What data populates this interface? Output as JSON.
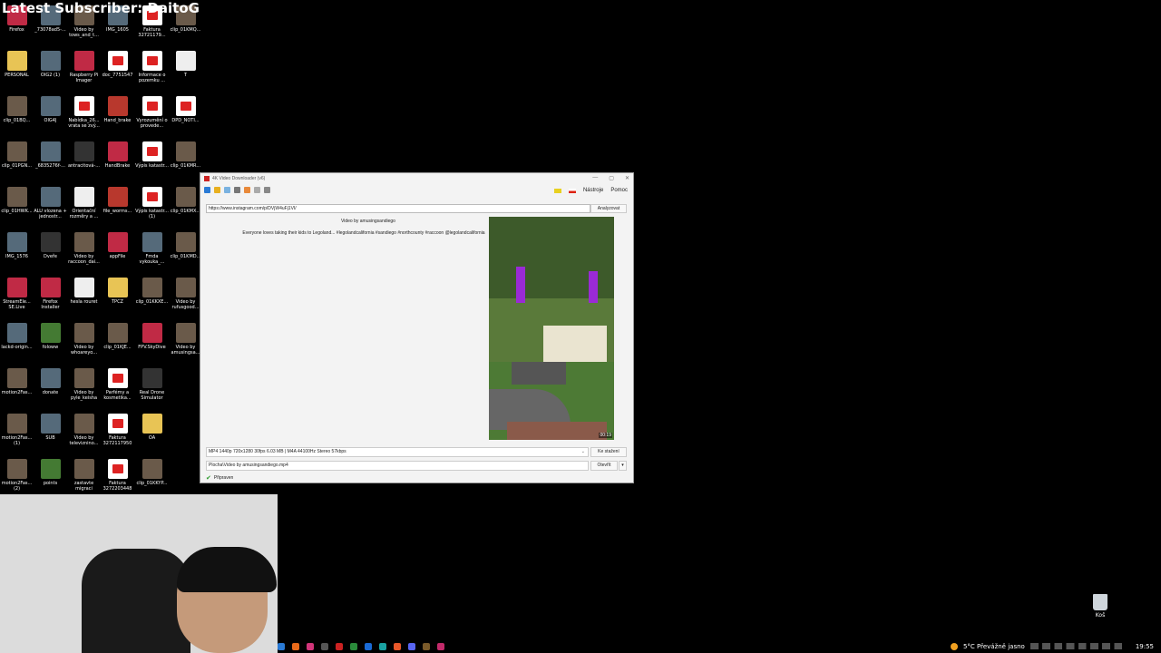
{
  "overlay": {
    "title": "Latest Subscriber: DaitoG"
  },
  "desktop_icons": [
    {
      "label": "Firefox",
      "kind": "app"
    },
    {
      "label": "_73078ad5-...",
      "kind": "photo"
    },
    {
      "label": "Video by tows_and_t...",
      "kind": "video"
    },
    {
      "label": "IMG_1605",
      "kind": "photo"
    },
    {
      "label": "Faktura 32721179...",
      "kind": "pdf"
    },
    {
      "label": "clip_01KMQ...",
      "kind": "video"
    },
    {
      "label": "PERSONAL",
      "kind": "folder"
    },
    {
      "label": "OIG2 (1)",
      "kind": "photo"
    },
    {
      "label": "Raspberry Pi Imager",
      "kind": "app"
    },
    {
      "label": "doc_7751547",
      "kind": "pdf"
    },
    {
      "label": "Informace o pozemku ...",
      "kind": "pdf"
    },
    {
      "label": "T",
      "kind": "doc"
    },
    {
      "label": "clip_01BQ...",
      "kind": "video"
    },
    {
      "label": "OIG4J",
      "kind": "photo"
    },
    {
      "label": "Nabídka_26... vrata se zvý...",
      "kind": "pdf"
    },
    {
      "label": "Hand_brake",
      "kind": "archive"
    },
    {
      "label": "Vyrozumění o provede...",
      "kind": "pdf"
    },
    {
      "label": "DPD_NOTI...",
      "kind": "pdf"
    },
    {
      "label": "clip_01PGN...",
      "kind": "video"
    },
    {
      "label": "_6835276f-...",
      "kind": "photo"
    },
    {
      "label": "antracitová-...",
      "kind": "dark"
    },
    {
      "label": "HandBrake",
      "kind": "app"
    },
    {
      "label": "Výpis katastr...",
      "kind": "pdf"
    },
    {
      "label": "clip_01KMR...",
      "kind": "video"
    },
    {
      "label": "clip_01HWK...",
      "kind": "video"
    },
    {
      "label": "ALU vlozena + jednostr...",
      "kind": "photo"
    },
    {
      "label": "Orientační rozměry a ...",
      "kind": "doc"
    },
    {
      "label": "file_worms...",
      "kind": "archive"
    },
    {
      "label": "Výpis katastr... (1)",
      "kind": "pdf"
    },
    {
      "label": "clip_01KMX...",
      "kind": "video"
    },
    {
      "label": "IMG_1576",
      "kind": "photo"
    },
    {
      "label": "Dveře",
      "kind": "dark"
    },
    {
      "label": "Video by raccoon_dai...",
      "kind": "video"
    },
    {
      "label": "appFile",
      "kind": "app"
    },
    {
      "label": "Fmda vykouka_...",
      "kind": "photo"
    },
    {
      "label": "clip_01KMD...",
      "kind": "video"
    },
    {
      "label": "StreamEle... SE.Live",
      "kind": "app"
    },
    {
      "label": "Firefox Installer",
      "kind": "app"
    },
    {
      "label": "hesla rouret",
      "kind": "doc"
    },
    {
      "label": "TPCZ",
      "kind": "folder"
    },
    {
      "label": "clip_01KKXE...",
      "kind": "video"
    },
    {
      "label": "Video by rufusgood...",
      "kind": "video"
    },
    {
      "label": "lackd-origin...",
      "kind": "photo"
    },
    {
      "label": "foloww",
      "kind": "game"
    },
    {
      "label": "Video by whoareyo...",
      "kind": "video"
    },
    {
      "label": "clip_01KJE...",
      "kind": "video"
    },
    {
      "label": "FPV.SkyDive",
      "kind": "app"
    },
    {
      "label": "Video by amusingsa...",
      "kind": "video"
    },
    {
      "label": "motion2Fas...",
      "kind": "video"
    },
    {
      "label": "donate",
      "kind": "photo"
    },
    {
      "label": "Video by pyle_keisha",
      "kind": "video"
    },
    {
      "label": "Parfémy a kosmetika...",
      "kind": "pdf"
    },
    {
      "label": "Real Drone Simulator",
      "kind": "dark"
    },
    {
      "label": "",
      "kind": "none"
    },
    {
      "label": "motion2Fas... (1)",
      "kind": "video"
    },
    {
      "label": "SUB",
      "kind": "photo"
    },
    {
      "label": "Video by televiznino...",
      "kind": "video"
    },
    {
      "label": "Faktura 3272117950",
      "kind": "pdf"
    },
    {
      "label": "OA",
      "kind": "folder"
    },
    {
      "label": "",
      "kind": "none"
    },
    {
      "label": "motion2Fas... (2)",
      "kind": "video"
    },
    {
      "label": "points",
      "kind": "game"
    },
    {
      "label": "zastavte migraci",
      "kind": "video"
    },
    {
      "label": "Faktura 3272203448",
      "kind": "pdf"
    },
    {
      "label": "clip_01KKYP...",
      "kind": "video"
    },
    {
      "label": "",
      "kind": "none"
    }
  ],
  "window": {
    "title": "4K Video Downloader (v6)",
    "menu": {
      "tools": "Nástroje",
      "help": "Pomoc"
    },
    "url": "https://www.instagram.com/p/DVjW4uFj1VI/",
    "analyze_label": "Analyzovat",
    "video_title": "Video by amusingsandiego",
    "description": "Everyone loves taking their kids to Legoland... #legolandcalifornia #sandiego #northcounty #raccoon @legolandcalifornia",
    "duration": "00:19",
    "format": "MP4 1440p 720x1280 30fps 6.03 MB | M4A 44100Hz Stereo 57kbps",
    "download_label": "Ke stažení",
    "path": "Plocha\\Video by amusingsandiego.mp4",
    "open_label": "Otevřít",
    "status": "Připraven"
  },
  "taskbar": {
    "weather": "5°C  Převážně jasno",
    "time": "19:55"
  },
  "recycle_bin": {
    "label": "Koš"
  },
  "colors": {
    "pdf_red": "#d22222",
    "accent_blue": "#2a7ad5"
  }
}
